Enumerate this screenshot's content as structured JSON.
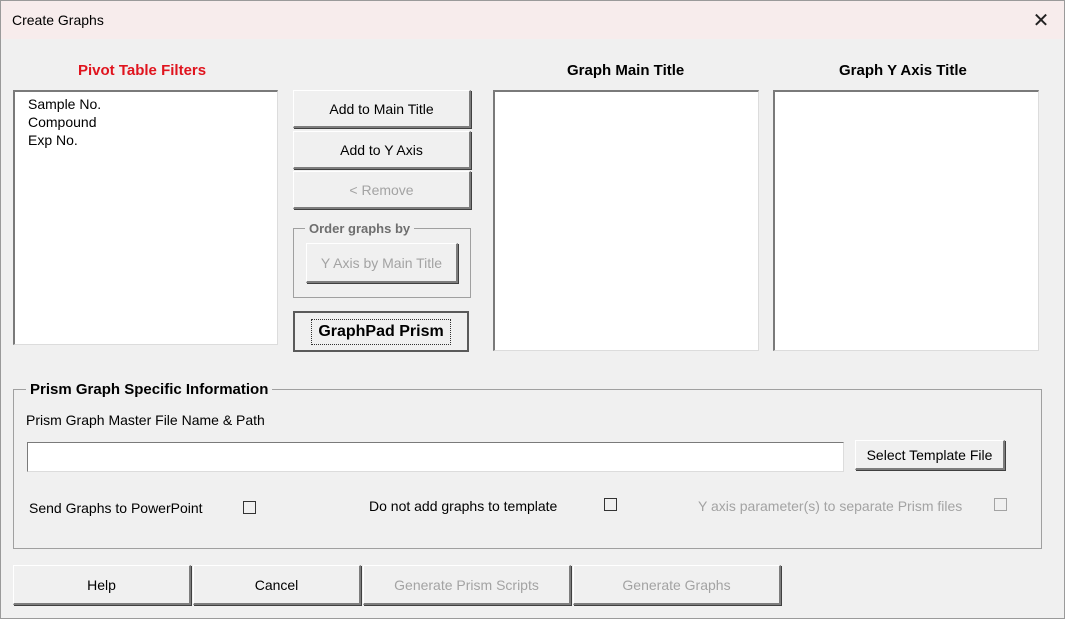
{
  "window": {
    "title": "Create Graphs"
  },
  "labels": {
    "pivot_filters": "Pivot Table Filters",
    "main_title": "Graph Main Title",
    "y_axis_title": "Graph Y Axis Title"
  },
  "pivot_list": {
    "items": [
      "Sample No.",
      "Compound",
      "Exp No."
    ]
  },
  "buttons": {
    "add_main_title": "Add to Main Title",
    "add_y_axis": "Add to Y Axis",
    "remove": "< Remove",
    "order_y_by_main": "Y Axis by Main Title",
    "graphpad_prism": "GraphPad Prism",
    "select_template": "Select Template File",
    "help": "Help",
    "cancel": "Cancel",
    "generate_scripts": "Generate Prism Scripts",
    "generate_graphs": "Generate Graphs"
  },
  "order_group": {
    "legend": "Order graphs by"
  },
  "prism_group": {
    "legend": "Prism Graph Specific Information",
    "master_file_label": "Prism Graph Master File Name & Path",
    "master_file_value": "",
    "send_to_ppt_label": "Send Graphs to PowerPoint",
    "send_to_ppt_checked": false,
    "no_add_template_label": "Do not add graphs to template",
    "no_add_template_checked": false,
    "y_axis_separate_label": "Y axis parameter(s) to separate Prism files",
    "y_axis_separate_checked": false
  },
  "colors": {
    "accent_red": "#e0141e",
    "disabled_text": "#a3a3a3"
  }
}
